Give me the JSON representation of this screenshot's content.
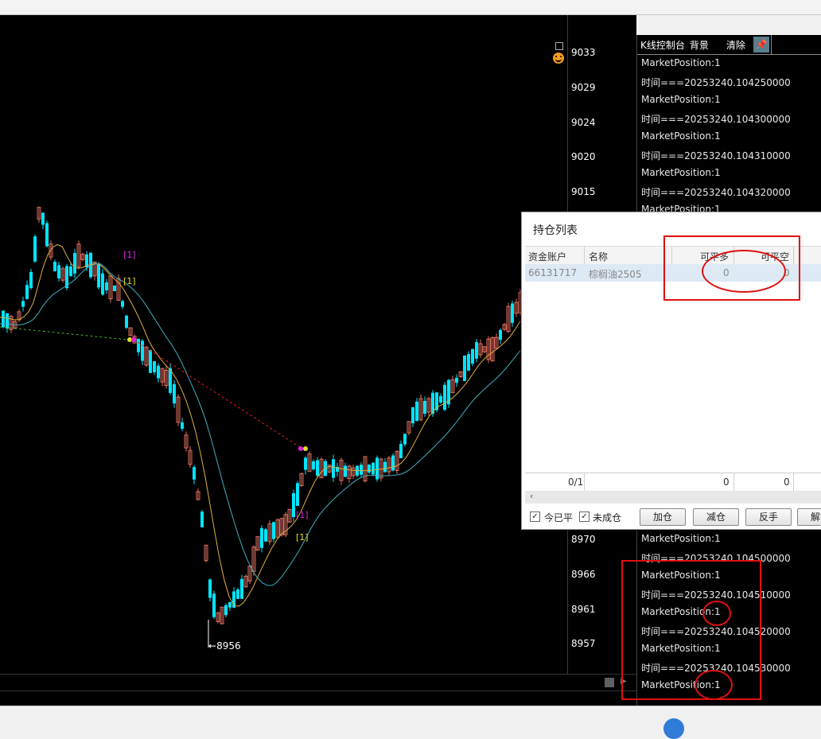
{
  "price_axis": {
    "labels": [
      "9033",
      "9029",
      "9024",
      "9020",
      "9015",
      "8970",
      "8966",
      "8961",
      "8957"
    ]
  },
  "chart": {
    "low_marker": "8956",
    "signal_labels": [
      "[1]",
      "[1]",
      "[1]",
      "[1]"
    ]
  },
  "console": {
    "title": "K线控制台",
    "background_label": "背景",
    "clear_label": "清除",
    "lines": [
      "MarketPosition:1",
      "时间===20253240.104250000",
      "MarketPosition:1",
      "时间===20253240.104300000",
      "MarketPosition:1",
      "时间===20253240.104310000",
      "MarketPosition:1",
      "时间===20253240.104320000",
      "MarketPosition:1"
    ],
    "lines_bottom": [
      "MarketPosition:1",
      "时间===20253240.104500000",
      "MarketPosition:1",
      "时间===20253240.104510000",
      "MarketPosition:1",
      "时间===20253240.104520000",
      "MarketPosition:1",
      "时间===20253240.104530000",
      "MarketPosition:1"
    ]
  },
  "holdings": {
    "title": "持仓列表",
    "columns": [
      "资金账户",
      "名称",
      "可平多",
      "可平空"
    ],
    "row": {
      "account": "66131717",
      "name": "棕榈油2505",
      "long": "0",
      "short": "0"
    },
    "footer": {
      "count": "0/1",
      "long_total": "0",
      "short_total": "0"
    },
    "checkbox_today": "今已平",
    "checkbox_unfilled": "未成仓",
    "buttons": [
      "加仓",
      "减仓",
      "反手",
      "解锁"
    ]
  },
  "colors": {
    "bull": "#e07060",
    "bear": "#00e5ff",
    "ma_short": "#e0b040",
    "ma_long": "#40b0c0",
    "annotation": "#e01010"
  }
}
